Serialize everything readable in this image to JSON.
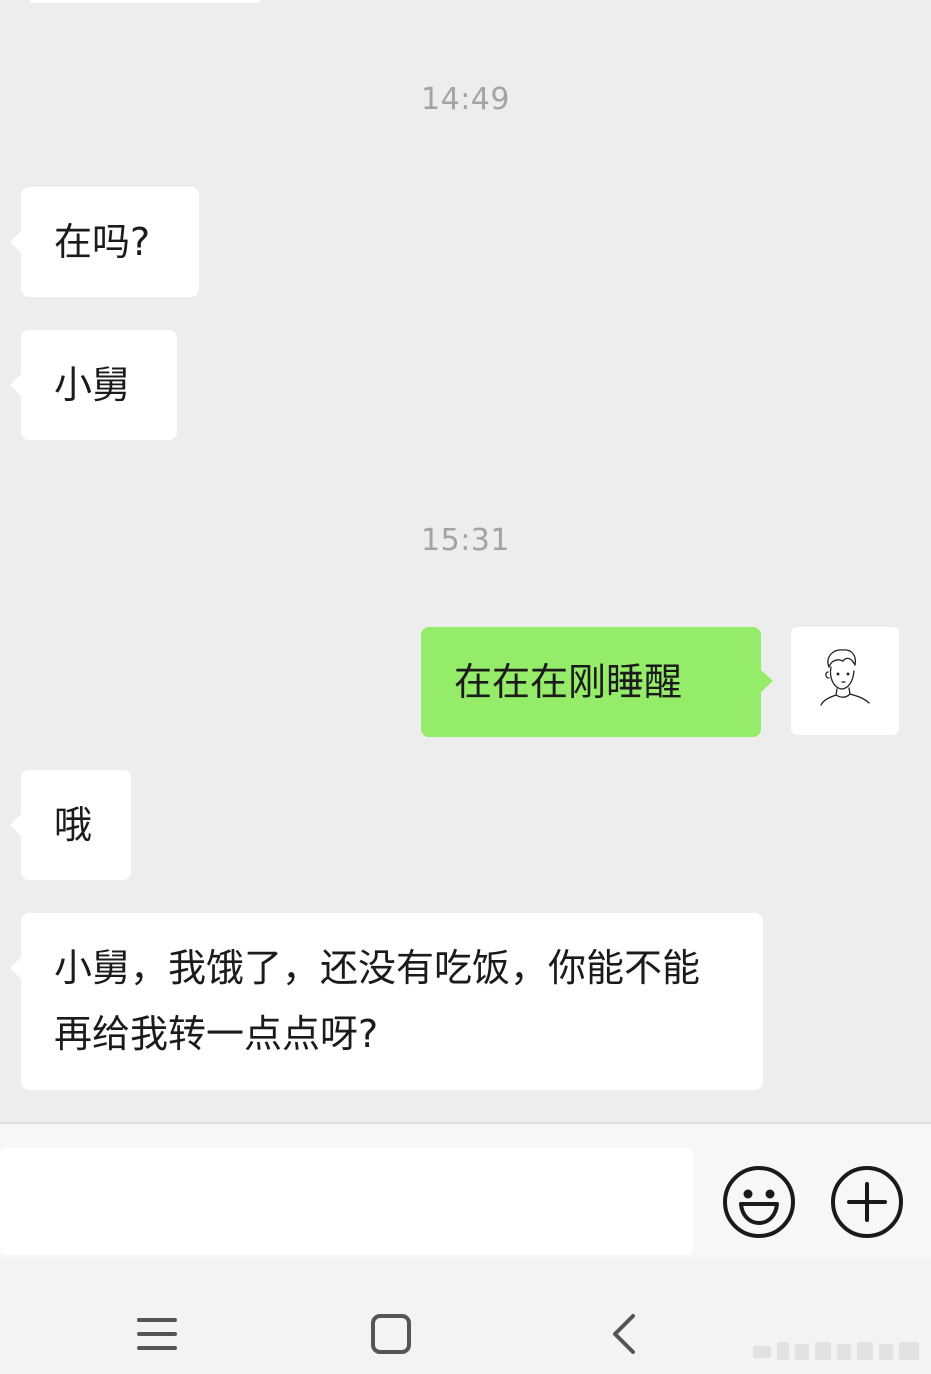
{
  "chat": {
    "messages": [
      {
        "type": "time",
        "text": "14:49"
      },
      {
        "type": "in",
        "text": "在吗?"
      },
      {
        "type": "in",
        "text": "小舅"
      },
      {
        "type": "time",
        "text": "15:31"
      },
      {
        "type": "out",
        "text": "在在在刚睡醒"
      },
      {
        "type": "in",
        "text": "哦"
      },
      {
        "type": "in",
        "text": "小舅，我饿了，还没有吃饭，你能不能再给我转一点点呀?"
      }
    ]
  },
  "avatar": {
    "icon": "sketch-boy-avatar-icon"
  },
  "input_bar": {
    "placeholder": "",
    "emoji_icon": "smiley-face-icon",
    "plus_icon": "plus-circle-icon"
  },
  "nav_bar": {
    "menu_icon": "menu-lines-icon",
    "home_icon": "home-square-icon",
    "back_icon": "back-chevron-icon"
  },
  "colors": {
    "chat_background": "#ededed",
    "incoming_bubble": "#ffffff",
    "outgoing_bubble": "#95ec69",
    "timestamp_text": "#a3a3a3"
  }
}
